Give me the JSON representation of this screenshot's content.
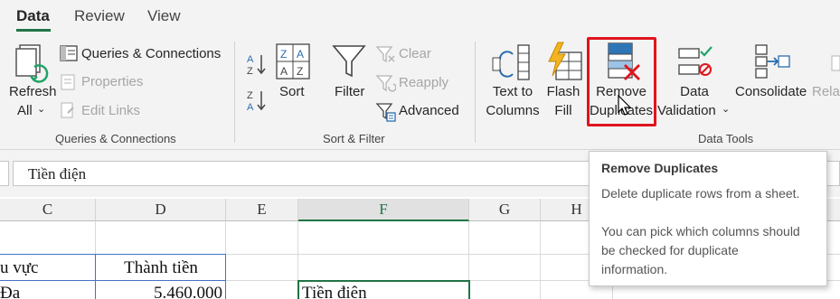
{
  "tabs": [
    {
      "label": "Data",
      "active": true
    },
    {
      "label": "Review",
      "active": false
    },
    {
      "label": "View",
      "active": false
    }
  ],
  "queries": {
    "refresh_line1": "Refresh",
    "refresh_line2": "All",
    "queries_connections": "Queries & Connections",
    "properties": "Properties",
    "edit_links": "Edit Links",
    "group_label": "Queries & Connections"
  },
  "sort_filter": {
    "sort": "Sort",
    "filter": "Filter",
    "clear": "Clear",
    "reapply": "Reapply",
    "advanced": "Advanced",
    "group_label": "Sort & Filter"
  },
  "data_tools": {
    "text_to_columns_1": "Text to",
    "text_to_columns_2": "Columns",
    "flash_fill_1": "Flash",
    "flash_fill_2": "Fill",
    "remove_dup_1": "Remove",
    "remove_dup_2": "Duplicates",
    "validation_1": "Data",
    "validation_2": "Validation",
    "consolidate": "Consolidate",
    "relationships_partial": "Relat",
    "group_label": "Data Tools"
  },
  "formula_bar": {
    "value": "Tiền điện"
  },
  "grid": {
    "columns": [
      "C",
      "D",
      "E",
      "F",
      "G",
      "H"
    ],
    "selected_column": "F",
    "c_header_cell": "u vực",
    "d_header_cell": "Thành tiền",
    "c_row_cell": "Đa",
    "d_row_cell": "5.460.000",
    "f_row_cell": "Tiền điện"
  },
  "tooltip": {
    "title": "Remove Duplicates",
    "line1": "Delete duplicate rows from a sheet.",
    "line2": "You can pick which columns should",
    "line3": "be checked for duplicate",
    "line4": "information."
  },
  "colors": {
    "accent": "#217346",
    "highlight": "#e0141e"
  },
  "icons": [
    "refresh-all-icon",
    "queries-connections-icon",
    "properties-icon",
    "edit-links-icon",
    "sort-az-icon",
    "sort-za-icon",
    "sort-icon",
    "filter-icon",
    "clear-filter-icon",
    "reapply-icon",
    "advanced-filter-icon",
    "text-to-columns-icon",
    "flash-fill-icon",
    "remove-duplicates-icon",
    "data-validation-icon",
    "consolidate-icon",
    "mouse-cursor-icon"
  ]
}
